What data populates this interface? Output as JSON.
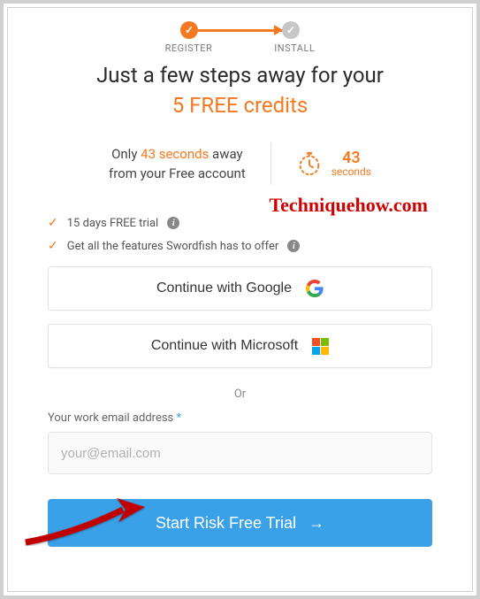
{
  "stepper": {
    "step1_label": "REGISTER",
    "step2_label": "INSTALL"
  },
  "headline": "Just a few steps away for your",
  "subhead": "5 FREE credits",
  "timer": {
    "prefix": "Only ",
    "seconds_text": "43 seconds",
    "suffix_line1": " away",
    "line2": "from your Free account",
    "countdown_value": "43",
    "countdown_unit": "seconds"
  },
  "watermark": "Techniquehow.com",
  "features": {
    "item1": "15 days FREE trial",
    "item2": "Get all the features Swordfish has to offer"
  },
  "oauth": {
    "google_label": "Continue with Google",
    "microsoft_label": "Continue with Microsoft"
  },
  "separator": "Or",
  "email": {
    "label": "Your work email address",
    "required_mark": "*",
    "placeholder": "your@email.com"
  },
  "cta": {
    "label": "Start Risk Free Trial"
  }
}
